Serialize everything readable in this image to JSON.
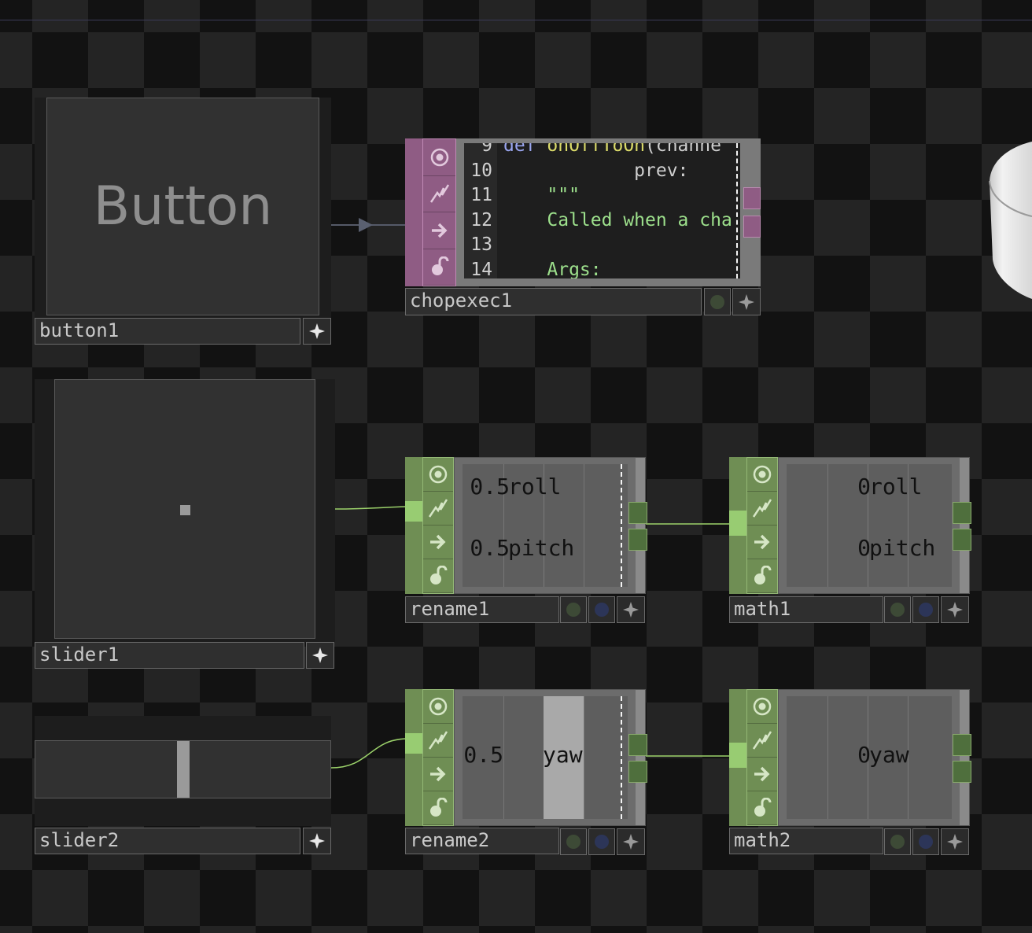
{
  "colors": {
    "chop_green": "#6f8e54",
    "dat_pink": "#8f5c84",
    "wire_green": "#9bd16a"
  },
  "button1": {
    "face_label": "Button",
    "name": "button1",
    "menu_icon": "star4-icon"
  },
  "slider1": {
    "name": "slider1"
  },
  "slider2": {
    "name": "slider2",
    "value": 0.5
  },
  "chopexec1": {
    "name": "chopexec1",
    "code_lines": [
      {
        "num": "9",
        "text_kw": "def ",
        "text_fn": "onOffToOn",
        "text_rest": "(channe"
      },
      {
        "num": "10",
        "text_kw": "",
        "text_fn": "",
        "text_rest": "            prev: "
      },
      {
        "num": "11",
        "text_kw": "",
        "text_fn": "",
        "text_rest": "    \"\"\""
      },
      {
        "num": "12",
        "text_kw": "",
        "text_fn": "",
        "text_rest": "    Called when a cha"
      },
      {
        "num": "13",
        "text_kw": "",
        "text_fn": "",
        "text_rest": ""
      },
      {
        "num": "14",
        "text_kw": "",
        "text_fn": "",
        "text_rest": "    Args:"
      }
    ]
  },
  "rename1": {
    "name": "rename1",
    "channels": [
      {
        "value": "0.5",
        "label": "roll"
      },
      {
        "value": "0.5",
        "label": "pitch"
      }
    ]
  },
  "math1": {
    "name": "math1",
    "channels": [
      {
        "value": "0",
        "label": "roll"
      },
      {
        "value": "0",
        "label": "pitch"
      }
    ]
  },
  "rename2": {
    "name": "rename2",
    "channels": [
      {
        "value": "0.5",
        "label": "yaw"
      }
    ]
  },
  "math2": {
    "name": "math2",
    "channels": [
      {
        "value": "0",
        "label": "yaw"
      }
    ]
  },
  "flags": [
    "viewer-flag-icon",
    "cook-flag-icon",
    "bypass-flag-icon",
    "lock-flag-icon"
  ]
}
